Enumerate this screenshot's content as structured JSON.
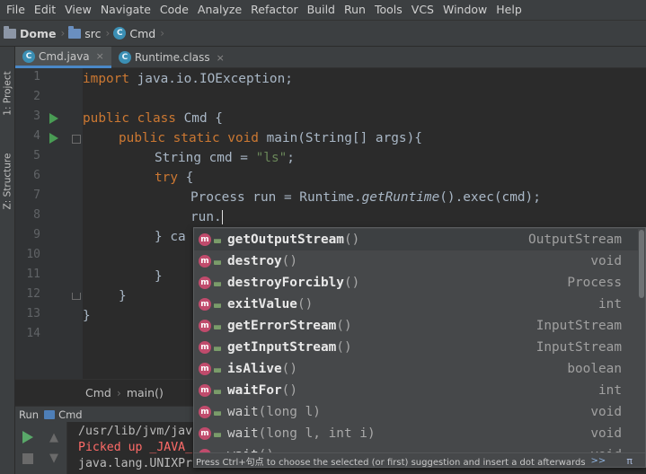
{
  "menu": [
    "File",
    "Edit",
    "View",
    "Navigate",
    "Code",
    "Analyze",
    "Refactor",
    "Build",
    "Run",
    "Tools",
    "VCS",
    "Window",
    "Help"
  ],
  "navbar": {
    "crumbs": [
      {
        "label": "Dome",
        "icon": "folder-icon"
      },
      {
        "label": "src",
        "icon": "folder-icon"
      },
      {
        "label": "Cmd",
        "icon": "class-icon"
      }
    ]
  },
  "side_tabs": {
    "project": "1: Project",
    "structure": "Z: Structure"
  },
  "tabs": [
    {
      "label": "Cmd.java",
      "close": "×",
      "active": true
    },
    {
      "label": "Runtime.class",
      "close": "×",
      "active": false
    }
  ],
  "line_numbers": [
    "1",
    "2",
    "3",
    "4",
    "5",
    "6",
    "7",
    "8",
    "9",
    "10",
    "11",
    "12",
    "13",
    "14"
  ],
  "code": {
    "l1": {
      "kw": "import",
      "rest": " java.io.IOException;"
    },
    "l3": {
      "kw": "public class",
      "rest": " Cmd {"
    },
    "l4": {
      "kw": "public static void",
      "rest": " main(String[] args){"
    },
    "l5": {
      "pre": "String cmd = ",
      "str": "\"ls\"",
      "post": ";"
    },
    "l6": {
      "kw": "try",
      "rest": " {"
    },
    "l7": {
      "pre": "Process run = Runtime.",
      "ital": "getRuntime",
      "post": "().exec(cmd);"
    },
    "l8": {
      "text": "run."
    },
    "l9": {
      "text": "} ca"
    },
    "l10": {
      "text": "("
    },
    "l11": {
      "text": "}"
    },
    "l12": {
      "text": "}"
    },
    "l13": {
      "text": "}"
    }
  },
  "editor_breadcrumb": {
    "class_label": "Cmd",
    "method_label": "main()"
  },
  "run_panel": {
    "title": "Run",
    "config": "Cmd",
    "lines": [
      {
        "text": "/usr/lib/jvm/jav",
        "error": false
      },
      {
        "text": "Picked up _JAVA_",
        "error": true
      },
      {
        "text": "java.lang.UNIXPr",
        "error": false
      }
    ]
  },
  "completion": {
    "items": [
      {
        "name": "getOutputStream",
        "params": "()",
        "type": "OutputStream",
        "bold": true
      },
      {
        "name": "destroy",
        "params": "()",
        "type": "void",
        "bold": true
      },
      {
        "name": "destroyForcibly",
        "params": "()",
        "type": "Process",
        "bold": true
      },
      {
        "name": "exitValue",
        "params": "()",
        "type": "int",
        "bold": true
      },
      {
        "name": "getErrorStream",
        "params": "()",
        "type": "InputStream",
        "bold": true
      },
      {
        "name": "getInputStream",
        "params": "()",
        "type": "InputStream",
        "bold": true
      },
      {
        "name": "isAlive",
        "params": "()",
        "type": "boolean",
        "bold": true
      },
      {
        "name": "waitFor",
        "params": "()",
        "type": "int",
        "bold": true
      },
      {
        "name": "wait",
        "params": "(long l)",
        "type": "void",
        "bold": false
      },
      {
        "name": "wait",
        "params": "(long l, int i)",
        "type": "void",
        "bold": false
      },
      {
        "name": "wait",
        "params": "()",
        "type": "void",
        "bold": false
      }
    ],
    "method_icon_letter": "m",
    "footer": "Press Ctrl+句点 to choose the selected (or first) suggestion and insert a dot afterwards",
    "footer_link": ">>",
    "pi": "π"
  },
  "colors": {
    "keyword": "#cc7832",
    "string": "#6a8759",
    "text": "#a9b7c6",
    "error": "#ff6b68",
    "method_icon": "#c04b6c"
  }
}
